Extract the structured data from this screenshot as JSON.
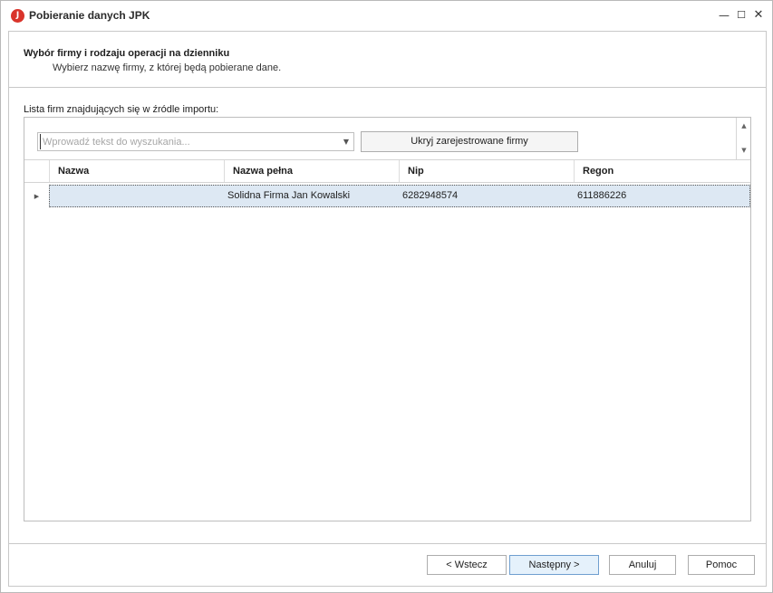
{
  "window": {
    "title": "Pobieranie danych JPK",
    "app_icon_letter": "J",
    "controls": {
      "minimize": "—",
      "maximize": "☐",
      "close": "✕"
    }
  },
  "header": {
    "title": "Wybór firmy i rodzaju operacji na dzienniku",
    "subtitle": "Wybierz nazwę firmy, z której będą pobierane dane."
  },
  "list": {
    "label": "Lista firm znajdujących się w źródle importu:",
    "search": {
      "value": "",
      "placeholder": "Wprowadź tekst do wyszukania..."
    },
    "hide_registered_button": "Ukryj zarejestrowane firmy",
    "columns": [
      "Nazwa",
      "Nazwa pełna",
      "Nip",
      "Regon"
    ],
    "rows": [
      {
        "nazwa": "",
        "nazwa_pelna": "Solidna Firma Jan Kowalski",
        "nip": "6282948574",
        "regon": "611886226",
        "selected": true
      }
    ]
  },
  "footer": {
    "back": "< Wstecz",
    "next": "Następny >",
    "cancel": "Anuluj",
    "help": "Pomoc"
  },
  "icons": {
    "app": "jpk-app-icon",
    "combo_arrow": "chevron-down-icon",
    "row_indicator": "triangle-right-icon",
    "scroll_up": "triangle-up-icon",
    "scroll_down": "triangle-down-icon"
  },
  "colors": {
    "app_icon": "#d9342b",
    "selected_row": "#dde8f3",
    "default_button": "#e5f1fb"
  }
}
